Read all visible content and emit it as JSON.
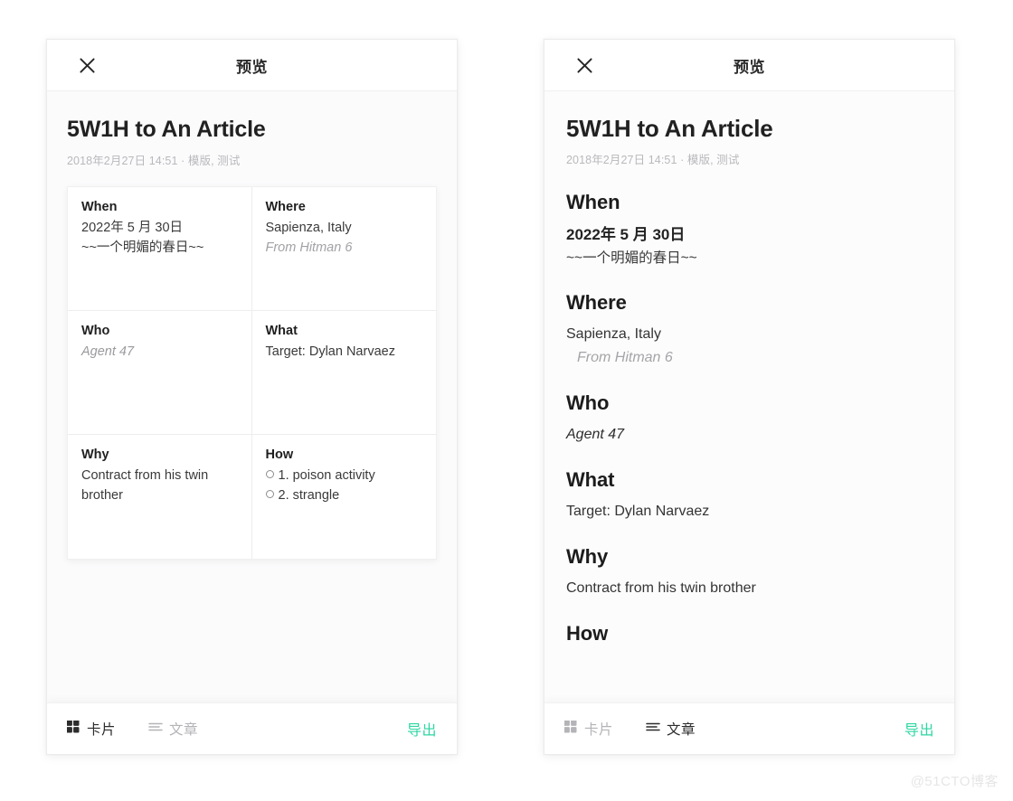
{
  "theme": {
    "accent_green": "#2fd6a3",
    "text_dark": "#2c2c2c",
    "text_muted": "#b4b4b8",
    "meta_gray": "#b9b9bd",
    "panel_bg": "#fbfbfc"
  },
  "panels": {
    "cards_view": {
      "topbar": {
        "close_icon": "close-icon",
        "title": "预览"
      },
      "document": {
        "title": "5W1H to An Article",
        "meta": "2018年2月27日 14:51 · 模版, 测试"
      },
      "cards": [
        {
          "heading": "When",
          "lines": [
            {
              "text": "2022年 5 月 30日",
              "style": "normal"
            },
            {
              "text": "~~一个明媚的春日~~",
              "style": "normal"
            }
          ]
        },
        {
          "heading": "Where",
          "lines": [
            {
              "text": "Sapienza, Italy",
              "style": "normal"
            },
            {
              "text": "From Hitman 6",
              "style": "quote"
            }
          ]
        },
        {
          "heading": "Who",
          "lines": [
            {
              "text": "Agent 47",
              "style": "em"
            }
          ]
        },
        {
          "heading": "What",
          "lines": [
            {
              "text": "Target: Dylan Narvaez",
              "style": "normal"
            }
          ]
        },
        {
          "heading": "Why",
          "lines": [
            {
              "text": "Contract from his twin brother",
              "style": "normal"
            }
          ]
        },
        {
          "heading": "How",
          "list": [
            "1. poison activity",
            "2. strangle"
          ]
        }
      ],
      "bottombar": {
        "cards_label": "卡片",
        "article_label": "文章",
        "export_label": "导出",
        "active_mode": "cards",
        "cards_icon": "grid-icon",
        "article_icon": "lines-icon"
      }
    },
    "article_view": {
      "topbar": {
        "close_icon": "close-icon",
        "title": "预览"
      },
      "document": {
        "title": "5W1H to An Article",
        "meta": "2018年2月27日 14:51 · 模版, 测试"
      },
      "sections": [
        {
          "heading": "When",
          "lines": [
            {
              "text": "2022年 5 月 30日",
              "style": "big"
            },
            {
              "text": "~~一个明媚的春日~~",
              "style": "cn"
            }
          ]
        },
        {
          "heading": "Where",
          "lines": [
            {
              "text": "Sapienza, Italy",
              "style": "normal"
            },
            {
              "text": "From Hitman 6",
              "style": "quote"
            }
          ]
        },
        {
          "heading": "Who",
          "lines": [
            {
              "text": "Agent 47",
              "style": "em"
            }
          ]
        },
        {
          "heading": "What",
          "lines": [
            {
              "text": "Target: Dylan Narvaez",
              "style": "normal"
            }
          ]
        },
        {
          "heading": "Why",
          "lines": [
            {
              "text": "Contract from his twin brother",
              "style": "normal"
            }
          ]
        },
        {
          "heading": "How",
          "lines": []
        }
      ],
      "bottombar": {
        "cards_label": "卡片",
        "article_label": "文章",
        "export_label": "导出",
        "active_mode": "article",
        "cards_icon": "grid-icon",
        "article_icon": "lines-icon"
      }
    }
  },
  "watermark": "@51CTO博客"
}
